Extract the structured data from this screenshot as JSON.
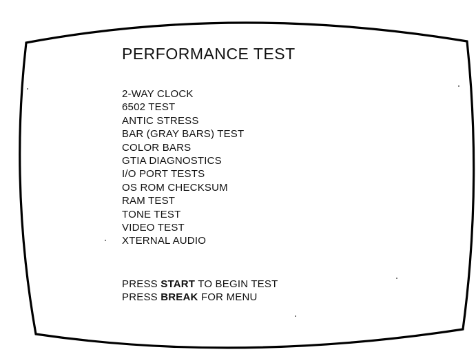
{
  "screen": {
    "title": "PERFORMANCE TEST",
    "menu_items": [
      "2-WAY CLOCK",
      "6502 TEST",
      "ANTIC STRESS",
      "BAR (GRAY BARS) TEST",
      "COLOR BARS",
      "GTIA DIAGNOSTICS",
      "I/O PORT TESTS",
      "OS ROM CHECKSUM",
      "RAM TEST",
      "TONE TEST",
      "VIDEO TEST",
      "XTERNAL AUDIO"
    ],
    "prompts": [
      {
        "prefix": "PRESS ",
        "key": "START",
        "suffix": " TO BEGIN TEST"
      },
      {
        "prefix": "PRESS ",
        "key": "BREAK",
        "suffix": " FOR MENU"
      }
    ]
  },
  "colors": {
    "background": "#ffffff",
    "text": "#111111",
    "frame": "#000000"
  }
}
